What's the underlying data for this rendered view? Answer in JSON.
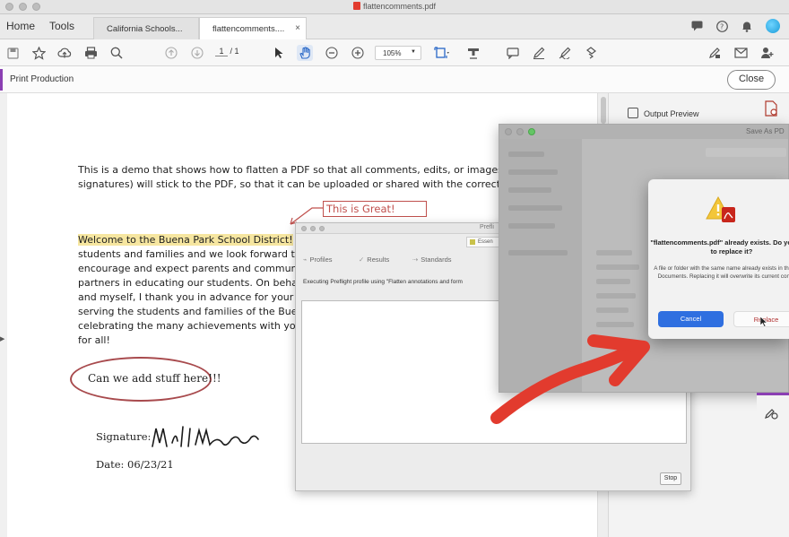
{
  "window": {
    "title": "flattencomments.pdf"
  },
  "menu": {
    "home": "Home",
    "tools": "Tools"
  },
  "tabs": [
    {
      "label": "California Schools...",
      "active": false
    },
    {
      "label": "flattencomments....",
      "active": true,
      "close": "×"
    }
  ],
  "toolbar": {
    "page_current": "1",
    "page_sep": "/",
    "page_total": "1",
    "zoom": "105%"
  },
  "subbar": {
    "title": "Print Production",
    "close_label": "Close"
  },
  "right_panel": {
    "output_preview": "Output Preview"
  },
  "document": {
    "intro_line1": "This is a demo that shows how to flatten a PDF so that all comments, edits, or images (inc",
    "intro_line2": "signatures) will stick to the PDF, so that it can be uploaded or shared with the correct edit",
    "welcome_highlight": "Welcome to the Buena Park School District!",
    "welcome_rest": " W",
    "body_lines": [
      "students and families and we look forward to a",
      "encourage and expect parents and community",
      "partners in educating our students. On behalf",
      "and myself, I thank you in advance for your co",
      "serving the students and families of the Buena",
      "celebrating the many achievements with you a",
      "for all!"
    ],
    "comment_note": "This is Great!",
    "circled_text": "Can we add stuff here!!!",
    "signature_label": "Signature:",
    "date_label": "Date:  06/23/21"
  },
  "preflight": {
    "title": "Prefli",
    "profile_select": "Essen",
    "tabs": [
      "Profiles",
      "Results",
      "Standards"
    ],
    "executing": "Executing Preflight profile using \"Flatten annotations and form",
    "stop_label": "Stop"
  },
  "save_dialog": {
    "title": "Save As PD"
  },
  "alert": {
    "headline": "\"flattencomments.pdf\" already exists. Do you want to replace it?",
    "body": "A file or folder with the same name already exists in the folder Documents. Replacing it will overwrite its current contents.",
    "cancel_label": "Cancel",
    "replace_label": "Replace"
  },
  "colors": {
    "annotation_red": "#c0504d",
    "arrow_red": "#e23b2e",
    "accent_purple": "#8b3fb3",
    "primary_blue": "#2f6fe0"
  }
}
